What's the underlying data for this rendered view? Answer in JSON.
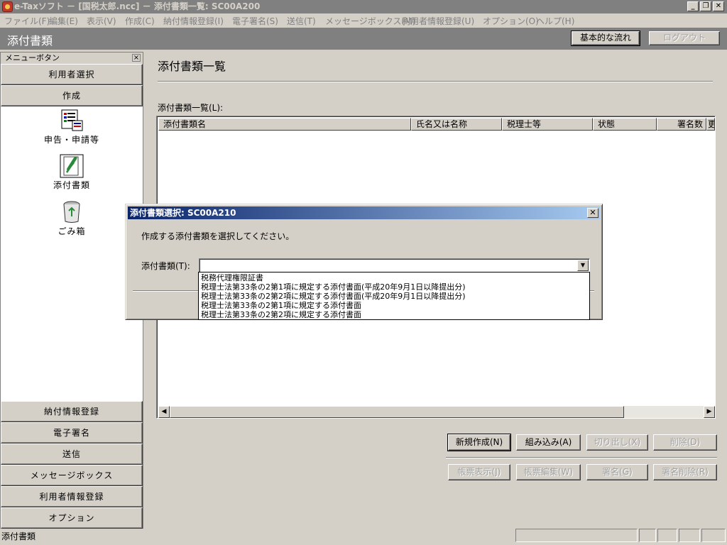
{
  "window": {
    "title": "e-Taxソフト － [国税太郎.ncc] － 添付書類一覧: SC00A200",
    "minimize": "_",
    "restore": "❐",
    "close": "✕"
  },
  "menubar": [
    "ファイル(F)",
    "編集(E)",
    "表示(V)",
    "作成(C)",
    "納付情報登録(I)",
    "電子署名(S)",
    "送信(T)",
    "メッセージボックス(M)",
    "利用者情報登録(U)",
    "オプション(O)",
    "ヘルプ(H)"
  ],
  "header": {
    "title": "添付書類",
    "flow_button": "基本的な流れ",
    "logout_button": "ログアウト"
  },
  "left_menu": {
    "caption": "メニューボタン",
    "close": "×",
    "top_buttons": [
      "利用者選択",
      "作成"
    ],
    "icons": [
      {
        "label": "申告・申請等",
        "icon": "report-icon"
      },
      {
        "label": "添付書類",
        "icon": "attachment-icon"
      },
      {
        "label": "ごみ箱",
        "icon": "trash-icon"
      }
    ],
    "bottom_buttons": [
      "納付情報登録",
      "電子署名",
      "送信",
      "メッセージボックス",
      "利用者情報登録",
      "オプション"
    ]
  },
  "main": {
    "title": "添付書類一覧",
    "list_label": "添付書類一覧(L):",
    "columns": [
      "添付書類名",
      "氏名又は名称",
      "税理士等",
      "状態",
      "署名数",
      "更"
    ],
    "buttons_row1": [
      {
        "label": "新規作成(N)",
        "enabled": true
      },
      {
        "label": "組み込み(A)",
        "enabled": true
      },
      {
        "label": "切り出し(X)",
        "enabled": false
      },
      {
        "label": "削除(D)",
        "enabled": false
      }
    ],
    "buttons_row2": [
      {
        "label": "帳票表示(J)",
        "enabled": false
      },
      {
        "label": "帳票編集(W)",
        "enabled": false
      },
      {
        "label": "署名(G)",
        "enabled": false
      },
      {
        "label": "署名削除(R)",
        "enabled": false
      }
    ]
  },
  "dialog": {
    "title": "添付書類選択: SC00A210",
    "close": "✕",
    "message": "作成する添付書類を選択してください。",
    "field_label": "添付書類(T):",
    "combo_value": "",
    "options": [
      "税務代理権限証書",
      "税理士法第33条の2第1項に規定する添付書面(平成20年9月1日以降提出分)",
      "税理士法第33条の2第2項に規定する添付書面(平成20年9月1日以降提出分)",
      "税理士法第33条の2第1項に規定する添付書面",
      "税理士法第33条の2第2項に規定する添付書面"
    ]
  },
  "statusbar": {
    "text": "添付書類"
  },
  "colors": {
    "titlebar_inactive": "#808080",
    "dialog_title_start": "#0a246a",
    "dialog_title_end": "#a6caf0",
    "face": "#d4d0c8"
  }
}
